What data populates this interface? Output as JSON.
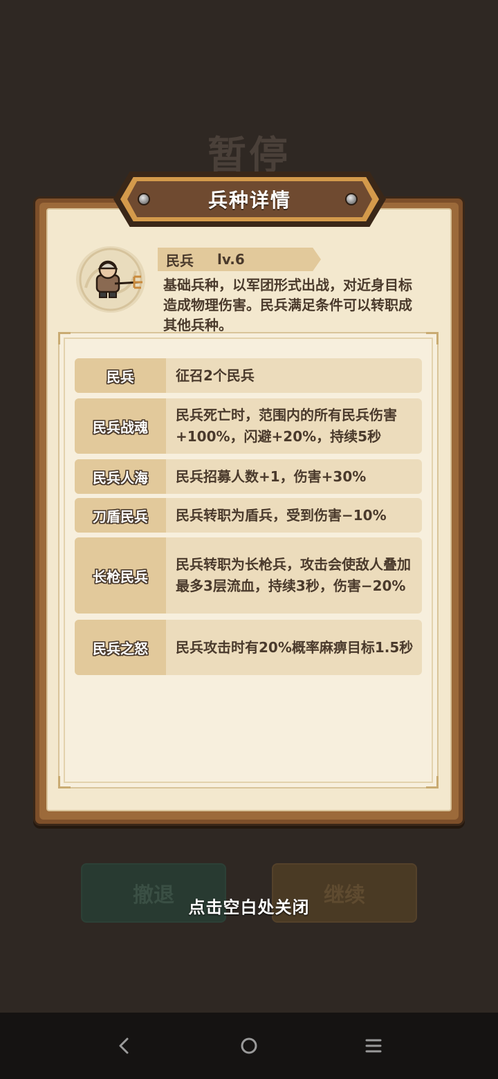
{
  "background": {
    "pause_title": "暂停",
    "retreat_label": "撤退",
    "continue_label": "继续"
  },
  "close_hint": "点击空白处关闭",
  "dialog": {
    "title": "兵种详情",
    "unit": {
      "name": "民兵",
      "level": "lv.6",
      "description": "基础兵种，以军团形式出战，对近身目标造成物理伤害。民兵满足条件可以转职成其他兵种。"
    },
    "skills": [
      {
        "name": "民兵",
        "desc": "征召2个民兵"
      },
      {
        "name": "民兵战魂",
        "desc": "民兵死亡时，范围内的所有民兵伤害+100%，闪避+20%，持续5秒"
      },
      {
        "name": "民兵人海",
        "desc": "民兵招募人数+1，伤害+30%"
      },
      {
        "name": "刀盾民兵",
        "desc": "民兵转职为盾兵，受到伤害−10%"
      },
      {
        "name": "长枪民兵",
        "desc": "民兵转职为长枪兵，攻击会使敌人叠加最多3层流血，持续3秒，伤害−20%"
      },
      {
        "name": "民兵之怒",
        "desc": "民兵攻击时有20%概率麻痹目标1.5秒"
      }
    ]
  },
  "icons": {
    "portrait": "militia-pitchfork-icon",
    "nav_back": "back-triangle-icon",
    "nav_home": "home-circle-icon",
    "nav_recents": "menu-lines-icon"
  }
}
